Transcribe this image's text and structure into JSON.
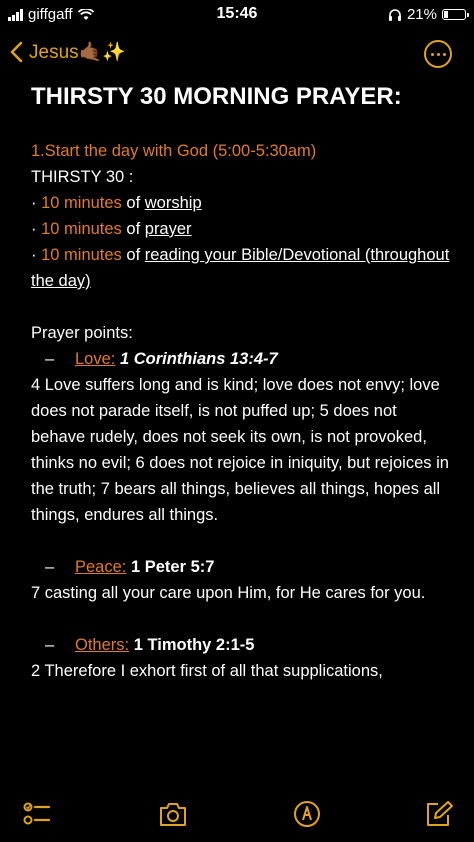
{
  "status": {
    "carrier": "giffgaff",
    "time": "15:46",
    "battery": "21%",
    "battery_level": 0.21
  },
  "nav": {
    "back_label": "Jesus🤙🏾✨"
  },
  "note": {
    "title": "THIRSTY 30 MORNING PRAYER:",
    "heading": "1.Start the day with God (5:00-5:30am)",
    "subheading": "THIRSTY 30 :",
    "bullets": [
      {
        "amount": "10 minutes",
        "of": "of",
        "activity": "worship"
      },
      {
        "amount": "10 minutes",
        "of": "of",
        "activity": "prayer"
      },
      {
        "amount": "10 minutes",
        "of": "of",
        "activity": "reading your Bible/Devotional (throughout the day)"
      }
    ],
    "prayer_points_label": "Prayer points:",
    "points": [
      {
        "label": "Love:",
        "reference": "1 Corinthians 13:4-7",
        "verse": "4 Love suffers long and is kind; love does not envy; love does not parade itself, is not puffed up; 5 does not behave rudely, does not seek its own, is not provoked, thinks no evil; 6 does not rejoice in iniquity, but rejoices in the truth; 7 bears all things, believes all things, hopes all things, endures all things."
      },
      {
        "label": "Peace:",
        "reference": "1 Peter 5:7",
        "verse": "7 casting all your care upon Him, for He cares for you."
      },
      {
        "label": "Others:",
        "reference": "1 Timothy 2:1-5",
        "verse": "2 Therefore I exhort first of all that supplications,"
      }
    ]
  },
  "toolbar": {
    "icons": [
      "checklist-icon",
      "camera-icon",
      "markup-pen-icon",
      "compose-icon"
    ]
  },
  "colors": {
    "accent": "#e0a320",
    "orange_text": "#e07b2a",
    "background": "#000000"
  }
}
